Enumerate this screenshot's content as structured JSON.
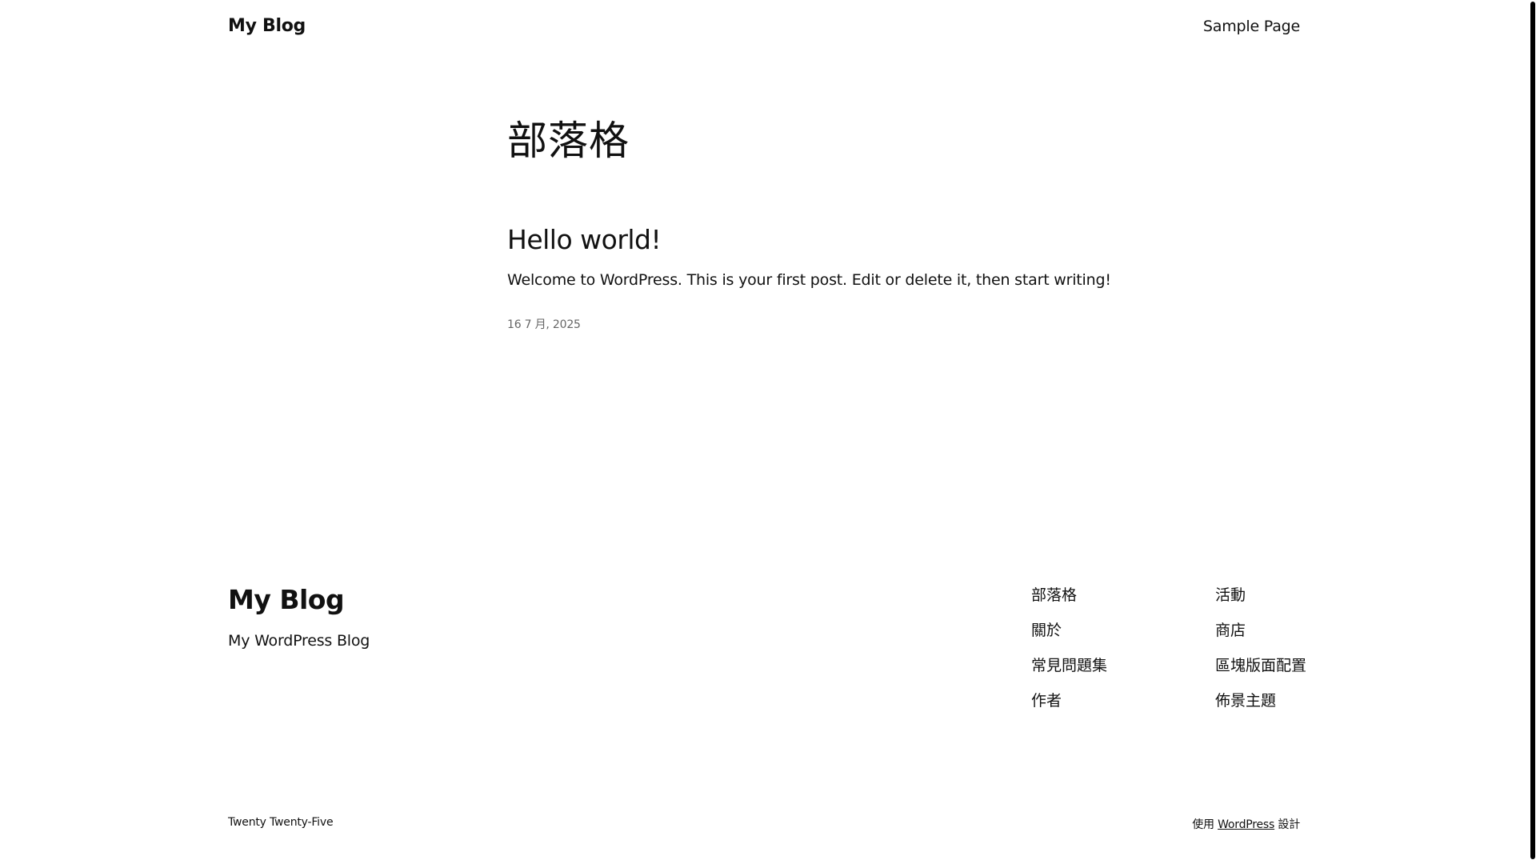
{
  "header": {
    "site_title": "My Blog",
    "nav": [
      {
        "label": "Sample Page"
      }
    ]
  },
  "main": {
    "page_title": "部落格",
    "posts": [
      {
        "title": "Hello world!",
        "excerpt": "Welcome to WordPress. This is your first post. Edit or delete it, then start writing!",
        "date": "16 7 月, 2025"
      }
    ]
  },
  "footer": {
    "site_title": "My Blog",
    "tagline": "My WordPress Blog",
    "nav_col_1": [
      {
        "label": "部落格"
      },
      {
        "label": "關於"
      },
      {
        "label": "常見問題集"
      },
      {
        "label": "作者"
      }
    ],
    "nav_col_2": [
      {
        "label": "活動"
      },
      {
        "label": "商店"
      },
      {
        "label": "區塊版面配置"
      },
      {
        "label": "佈景主題"
      }
    ],
    "theme_name": "Twenty Twenty-Five",
    "credit_prefix": "使用",
    "credit_link": "WordPress",
    "credit_suffix": "設計"
  }
}
